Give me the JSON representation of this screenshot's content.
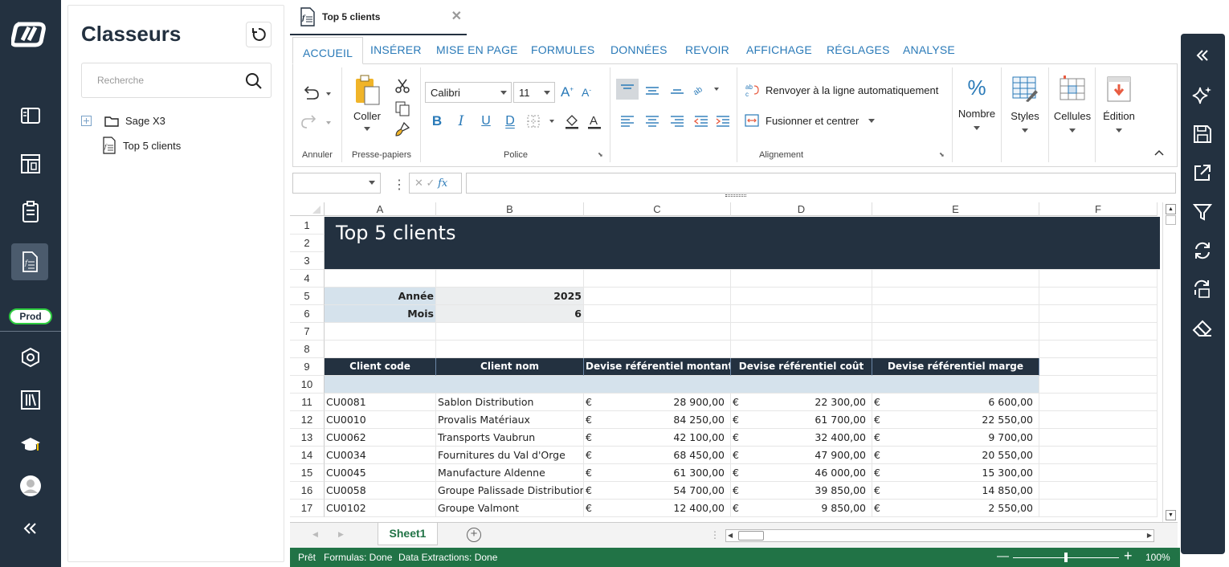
{
  "left_nav": {
    "env_badge": "Prod",
    "icons": [
      "app-logo",
      "panel-icon",
      "dashboard-icon",
      "clipboard-icon",
      "spreadsheet-icon",
      "settings-hex-icon",
      "library-icon",
      "graduation-cap-icon",
      "user-avatar-icon",
      "collapse-left-icon"
    ]
  },
  "panel": {
    "title": "Classeurs",
    "search_placeholder": "Recherche",
    "tree": [
      {
        "label": "Sage X3"
      },
      {
        "label": "Top 5 clients"
      }
    ]
  },
  "doc_tab": {
    "title": "Top 5 clients"
  },
  "ribbon_tabs": [
    "ACCUEIL",
    "INSÉRER",
    "MISE EN PAGE",
    "FORMULES",
    "DONNÉES",
    "REVOIR",
    "AFFICHAGE",
    "RÉGLAGES",
    "ANALYSE"
  ],
  "ribbon": {
    "undo_group": "Annuler",
    "clipboard_group": "Presse-papiers",
    "paste": "Coller",
    "font_group": "Police",
    "font_name": "Calibri",
    "font_size": "11",
    "bold": "B",
    "italic": "I",
    "underline": "U",
    "double_underline": "D",
    "align_group": "Alignement",
    "wrap_text": "Renvoyer à la ligne automatiquement",
    "merge_center": "Fusionner et centrer",
    "number": "Nombre",
    "styles": "Styles",
    "cells": "Cellules",
    "editing": "Édition"
  },
  "formula": {
    "fx": "fx"
  },
  "columns": [
    "A",
    "B",
    "C",
    "D",
    "E",
    "F"
  ],
  "rows": [
    "1",
    "2",
    "3",
    "4",
    "5",
    "6",
    "7",
    "8",
    "9",
    "10",
    "11",
    "12",
    "13",
    "14",
    "15",
    "16",
    "17"
  ],
  "sheet": {
    "title": "Top 5 clients",
    "params": [
      {
        "label": "Année",
        "value": "2025"
      },
      {
        "label": "Mois",
        "value": "6"
      }
    ],
    "headers": [
      "Client code",
      "Client nom",
      "Devise référentiel montant",
      "Devise référentiel coût",
      "Devise référentiel marge"
    ],
    "currency": "€",
    "data": [
      [
        "CU0081",
        "Sablon Distribution",
        "28 900,00",
        "22 300,00",
        "6 600,00"
      ],
      [
        "CU0010",
        "Provalis Matériaux",
        "84 250,00",
        "61 700,00",
        "22 550,00"
      ],
      [
        "CU0062",
        "Transports Vaubrun",
        "42 100,00",
        "32 400,00",
        "9 700,00"
      ],
      [
        "CU0034",
        "Fournitures du Val d'Orge",
        "68 450,00",
        "47 900,00",
        "20 550,00"
      ],
      [
        "CU0045",
        "Manufacture Aldenne",
        "61 300,00",
        "46 000,00",
        "15 300,00"
      ],
      [
        "CU0058",
        "Groupe Palissade Distribution",
        "54 700,00",
        "39 850,00",
        "14 850,00"
      ],
      [
        "CU0102",
        "Groupe Valmont",
        "12 400,00",
        "9 850,00",
        "2 550,00"
      ]
    ]
  },
  "sheet_tabs": [
    "Sheet1"
  ],
  "status": {
    "ready": "Prêt",
    "formulas": "Formulas: Done",
    "extractions": "Data Extractions: Done",
    "zoom": "100%",
    "zoom_level": 100
  },
  "right_bar": {
    "icons": [
      "collapse-right-icon",
      "sparkle-icon",
      "save-icon",
      "export-icon",
      "filter-icon",
      "refresh-icon",
      "sync-icon",
      "eraser-icon"
    ]
  }
}
